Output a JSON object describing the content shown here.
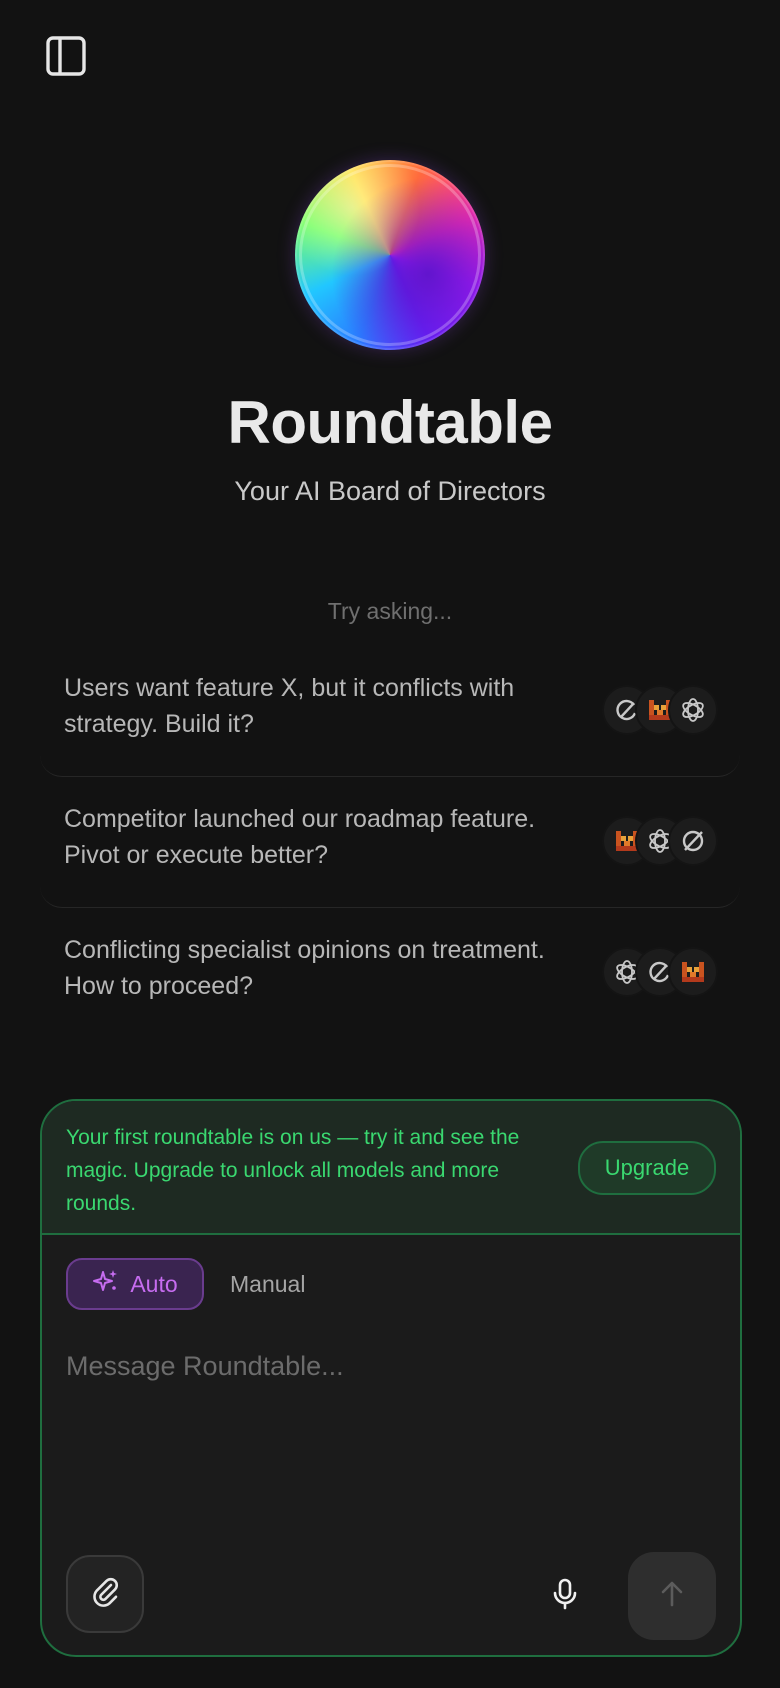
{
  "app": {
    "title": "Roundtable",
    "subtitle": "Your AI Board of Directors"
  },
  "icons": {
    "sidebar_toggle": "sidebar-panel-icon",
    "orb": "gradient-orb-logo",
    "attach": "paperclip-icon",
    "mic": "microphone-icon",
    "send": "arrow-up-icon",
    "auto_mode": "sparkles-icon"
  },
  "try_label": "Try asking...",
  "suggestions": [
    {
      "text": "Users want feature X, but it conflicts with strategy. Build it?",
      "models": [
        "perplexity-icon",
        "mistral-icon",
        "openai-icon"
      ]
    },
    {
      "text": "Competitor launched our roadmap feature. Pivot or execute better?",
      "models": [
        "mistral-icon",
        "openai-icon",
        "grok-icon"
      ]
    },
    {
      "text": "Conflicting specialist opinions on treatment. How to proceed?",
      "models": [
        "openai-icon",
        "perplexity-icon",
        "mistral-icon"
      ]
    }
  ],
  "promo": {
    "text": "Your first roundtable is on us — try it and see the magic. Upgrade to unlock all models and more rounds.",
    "button_label": "Upgrade"
  },
  "modes": {
    "auto_label": "Auto",
    "manual_label": "Manual",
    "selected": "Auto"
  },
  "composer": {
    "placeholder": "Message Roundtable...",
    "value": ""
  },
  "colors": {
    "background": "#121212",
    "accent_green": "#3ad870",
    "accent_purple": "#c66cf0",
    "border_green": "#1f6e3f"
  }
}
